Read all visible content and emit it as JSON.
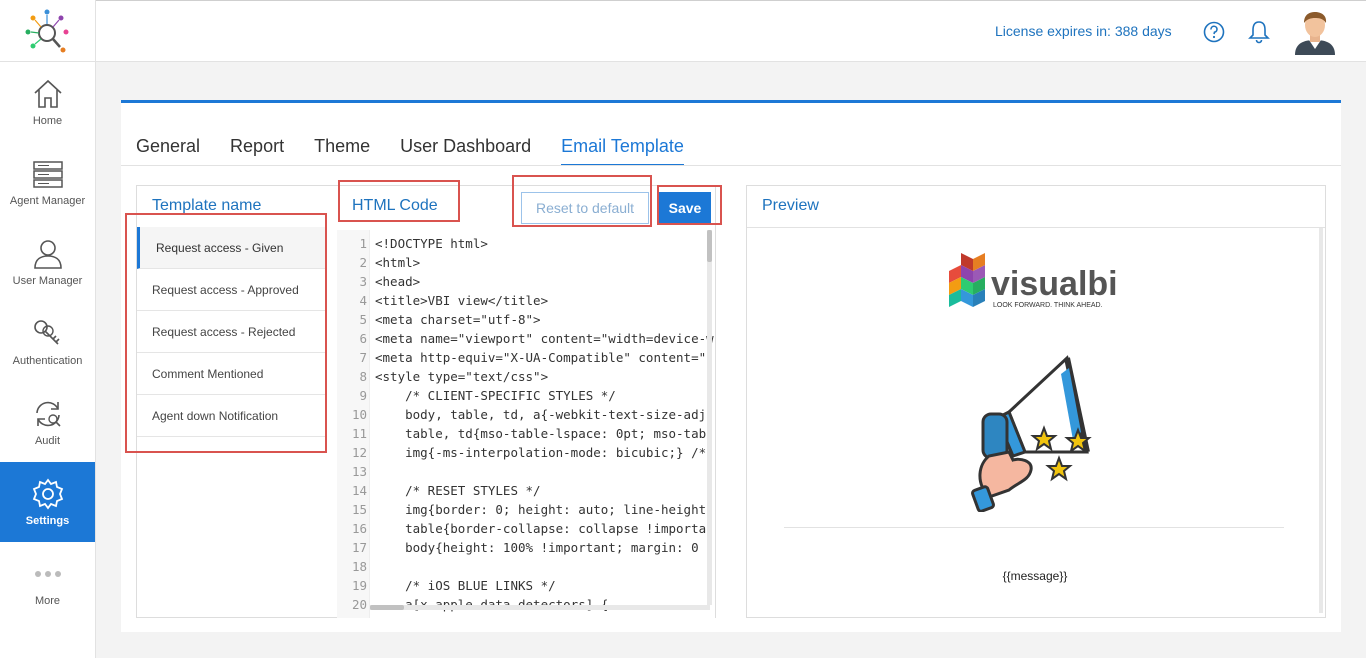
{
  "sidebar": {
    "items": [
      {
        "label": "Home",
        "icon": "home-icon"
      },
      {
        "label": "Agent Manager",
        "icon": "server-icon"
      },
      {
        "label": "User Manager",
        "icon": "user-icon"
      },
      {
        "label": "Authentication",
        "icon": "key-icon"
      },
      {
        "label": "Audit",
        "icon": "refresh-icon"
      },
      {
        "label": "Settings",
        "icon": "gear-icon",
        "active": true
      },
      {
        "label": "More",
        "icon": "more-dots-icon"
      }
    ]
  },
  "header": {
    "license": "License expires in: 388 days",
    "icons": [
      "help-icon",
      "bell-icon",
      "avatar"
    ]
  },
  "tabs": [
    {
      "label": "General"
    },
    {
      "label": "Report"
    },
    {
      "label": "Theme"
    },
    {
      "label": "User Dashboard"
    },
    {
      "label": "Email Template",
      "active": true
    }
  ],
  "templates": {
    "title": "Template name",
    "items": [
      {
        "label": "Request access - Given",
        "selected": true
      },
      {
        "label": "Request access - Approved"
      },
      {
        "label": "Request access - Rejected"
      },
      {
        "label": "Comment Mentioned"
      },
      {
        "label": "Agent down Notification"
      }
    ]
  },
  "code": {
    "title": "HTML Code",
    "reset_label": "Reset to default",
    "save_label": "Save",
    "lines": [
      {
        "n": "1",
        "text": "<!DOCTYPE html>"
      },
      {
        "n": "2",
        "text": "<html>"
      },
      {
        "n": "3",
        "text": "<head>"
      },
      {
        "n": "4",
        "text": "<title>VBI view</title>"
      },
      {
        "n": "5",
        "text": "<meta charset=\"utf-8\">"
      },
      {
        "n": "6",
        "text": "<meta name=\"viewport\" content=\"width=device-w"
      },
      {
        "n": "7",
        "text": "<meta http-equiv=\"X-UA-Compatible\" content=\""
      },
      {
        "n": "8",
        "text": "<style type=\"text/css\">"
      },
      {
        "n": "9",
        "text": "    /* CLIENT-SPECIFIC STYLES */"
      },
      {
        "n": "10",
        "text": "    body, table, td, a{-webkit-text-size-adj"
      },
      {
        "n": "11",
        "text": "    table, td{mso-table-lspace: 0pt; mso-tab"
      },
      {
        "n": "12",
        "text": "    img{-ms-interpolation-mode: bicubic;} /*"
      },
      {
        "n": "13",
        "text": ""
      },
      {
        "n": "14",
        "text": "    /* RESET STYLES */"
      },
      {
        "n": "15",
        "text": "    img{border: 0; height: auto; line-height"
      },
      {
        "n": "16",
        "text": "    table{border-collapse: collapse !importa"
      },
      {
        "n": "17",
        "text": "    body{height: 100% !important; margin: 0"
      },
      {
        "n": "18",
        "text": ""
      },
      {
        "n": "19",
        "text": "    /* iOS BLUE LINKS */"
      },
      {
        "n": "20",
        "text": "    a[x-apple-data-detectors] {"
      }
    ]
  },
  "preview": {
    "title": "Preview",
    "logo_text": "visualbi",
    "logo_tagline": "LOOK FORWARD. THINK AHEAD.",
    "message": "{{message}}"
  },
  "colors": {
    "accent": "#1c78d6",
    "highlight": "#d9534f"
  }
}
